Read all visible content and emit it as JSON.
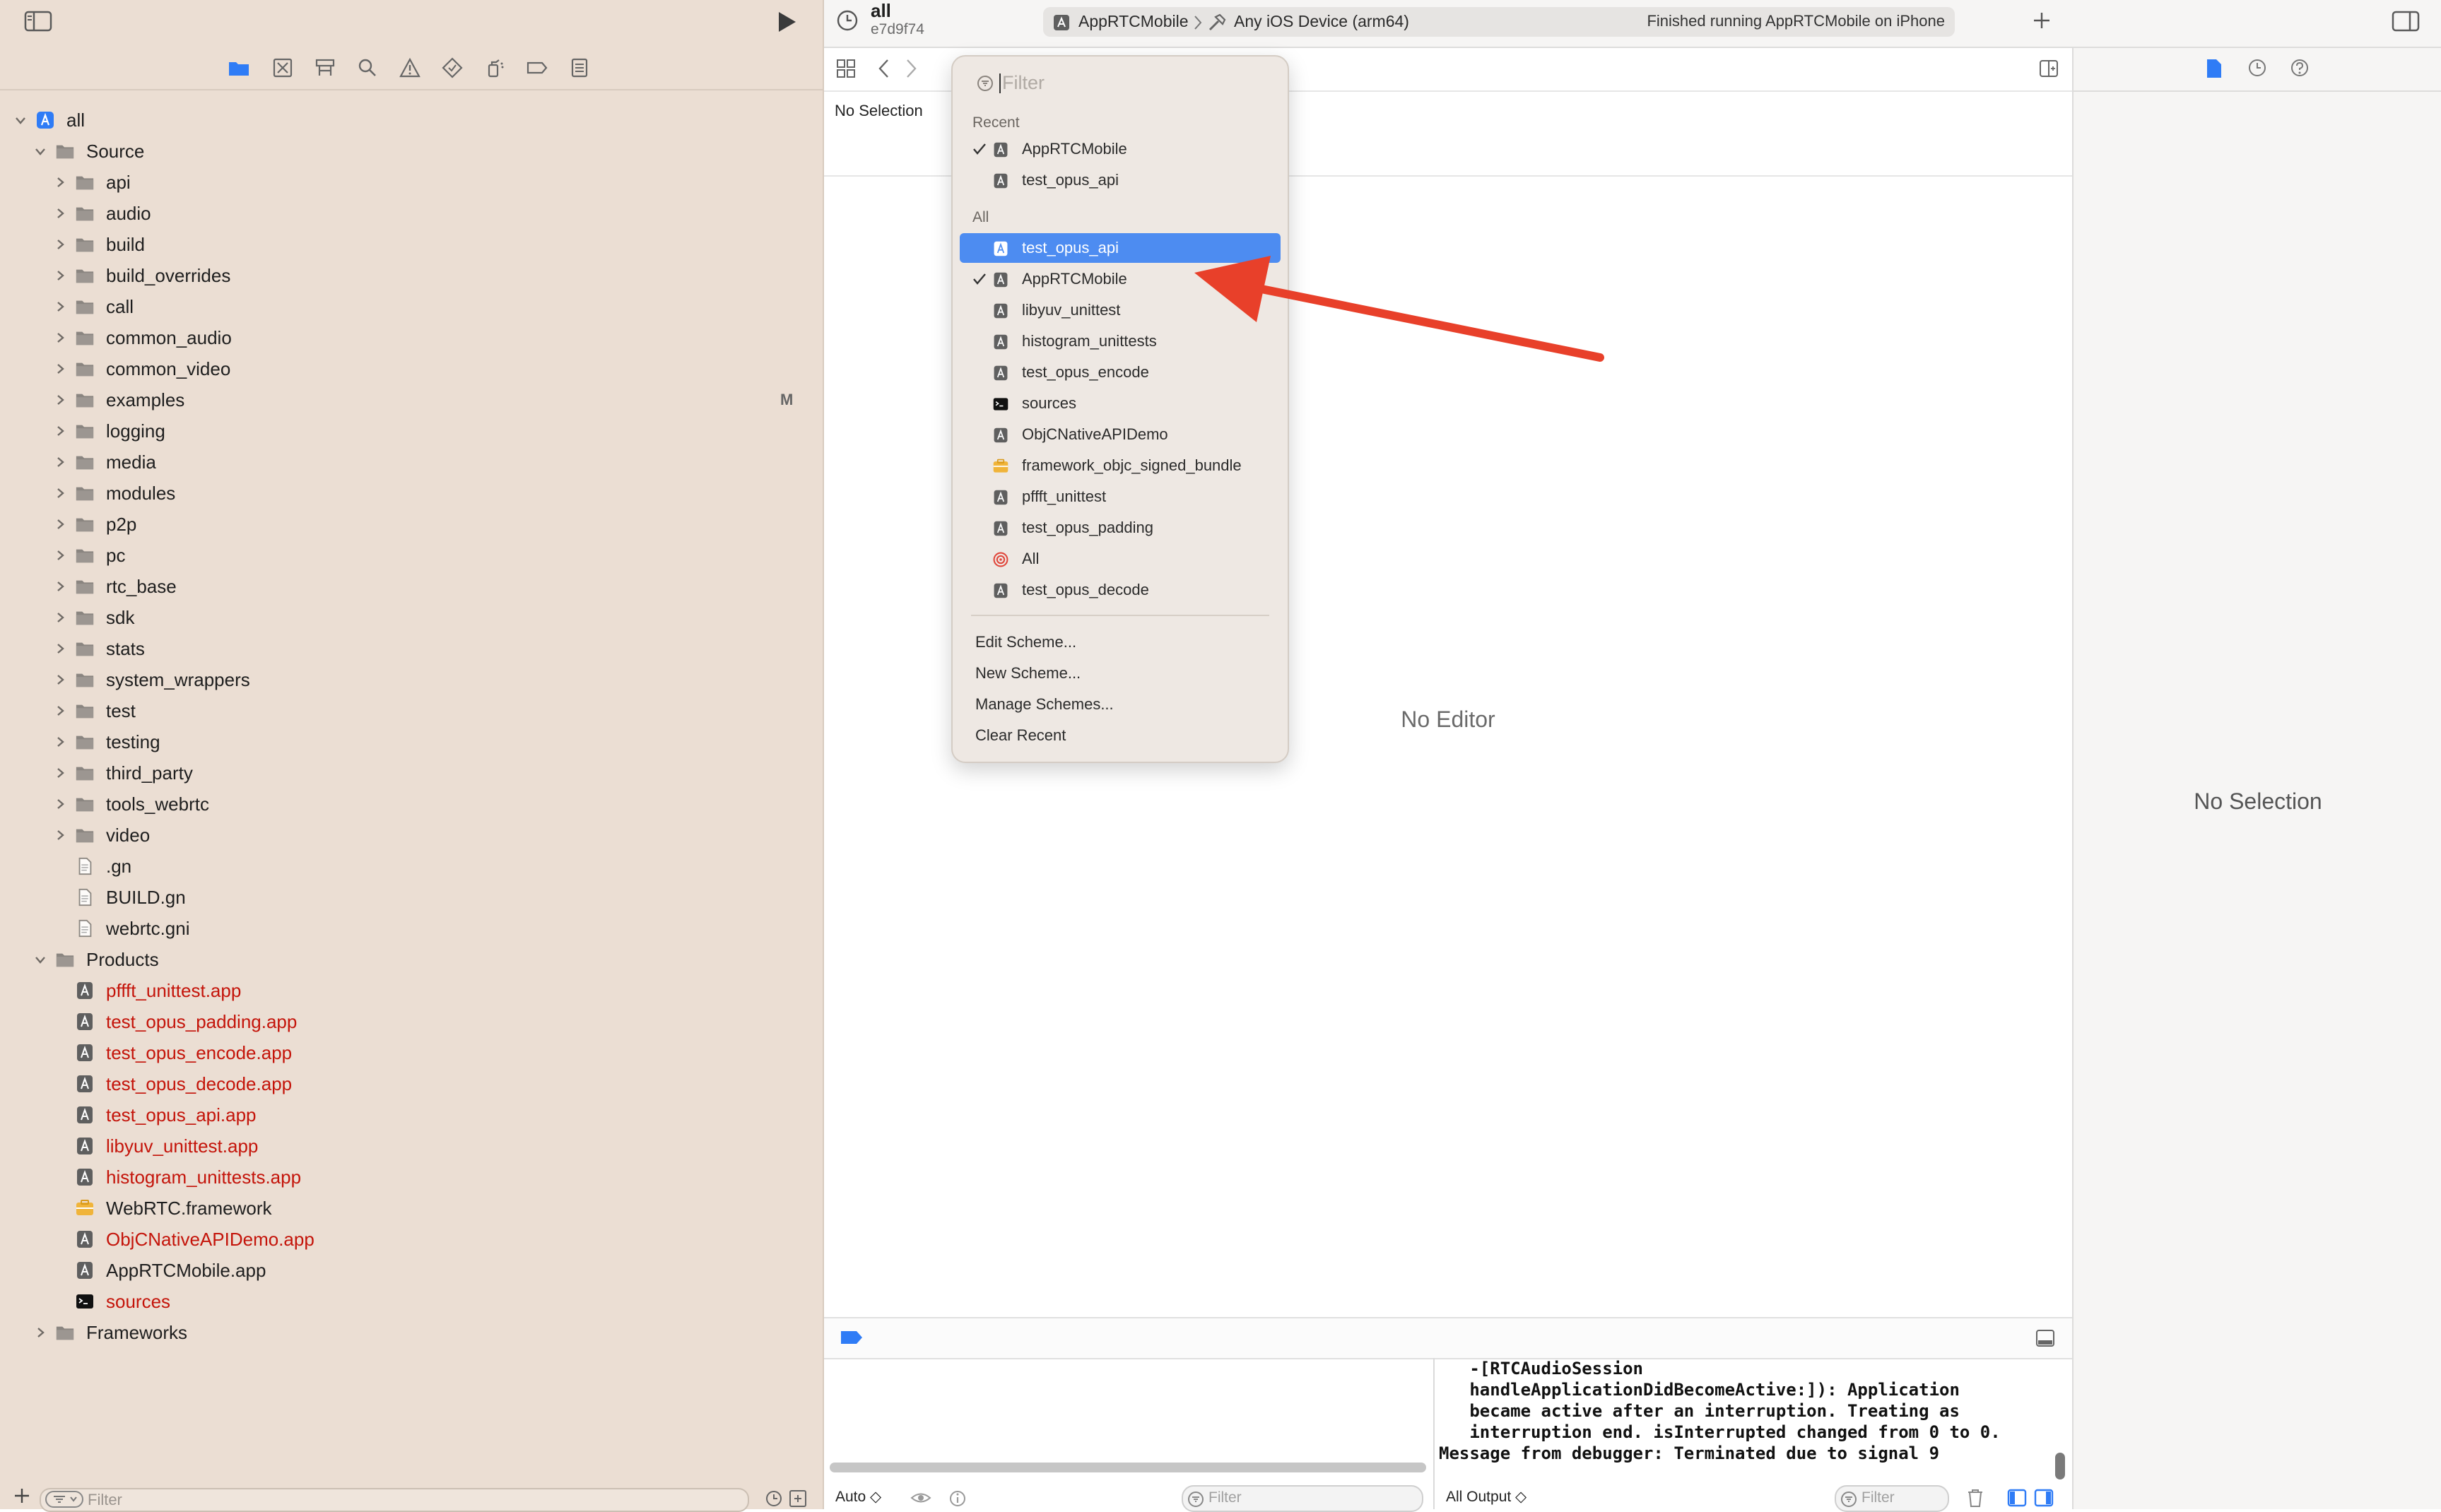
{
  "topbar": {
    "scheme_title": "all",
    "scheme_commit": "e7d9f74",
    "active_scheme": "AppRTCMobile",
    "destination": "Any iOS Device (arm64)",
    "status": "Finished running AppRTCMobile on iPhone"
  },
  "navigator": {
    "tree": [
      {
        "label": "all",
        "level": 0,
        "icon": "xcode-project-icon",
        "chevron": "down"
      },
      {
        "label": "Source",
        "level": 1,
        "icon": "folder-icon",
        "chevron": "down"
      },
      {
        "label": "api",
        "level": 2,
        "icon": "folder-icon",
        "chevron": "right"
      },
      {
        "label": "audio",
        "level": 2,
        "icon": "folder-icon",
        "chevron": "right"
      },
      {
        "label": "build",
        "level": 2,
        "icon": "folder-icon",
        "chevron": "right"
      },
      {
        "label": "build_overrides",
        "level": 2,
        "icon": "folder-icon",
        "chevron": "right"
      },
      {
        "label": "call",
        "level": 2,
        "icon": "folder-icon",
        "chevron": "right"
      },
      {
        "label": "common_audio",
        "level": 2,
        "icon": "folder-icon",
        "chevron": "right"
      },
      {
        "label": "common_video",
        "level": 2,
        "icon": "folder-icon",
        "chevron": "right"
      },
      {
        "label": "examples",
        "level": 2,
        "icon": "folder-icon",
        "chevron": "right",
        "badge": "M"
      },
      {
        "label": "logging",
        "level": 2,
        "icon": "folder-icon",
        "chevron": "right"
      },
      {
        "label": "media",
        "level": 2,
        "icon": "folder-icon",
        "chevron": "right"
      },
      {
        "label": "modules",
        "level": 2,
        "icon": "folder-icon",
        "chevron": "right"
      },
      {
        "label": "p2p",
        "level": 2,
        "icon": "folder-icon",
        "chevron": "right"
      },
      {
        "label": "pc",
        "level": 2,
        "icon": "folder-icon",
        "chevron": "right"
      },
      {
        "label": "rtc_base",
        "level": 2,
        "icon": "folder-icon",
        "chevron": "right"
      },
      {
        "label": "sdk",
        "level": 2,
        "icon": "folder-icon",
        "chevron": "right"
      },
      {
        "label": "stats",
        "level": 2,
        "icon": "folder-icon",
        "chevron": "right"
      },
      {
        "label": "system_wrappers",
        "level": 2,
        "icon": "folder-icon",
        "chevron": "right"
      },
      {
        "label": "test",
        "level": 2,
        "icon": "folder-icon",
        "chevron": "right"
      },
      {
        "label": "testing",
        "level": 2,
        "icon": "folder-icon",
        "chevron": "right"
      },
      {
        "label": "third_party",
        "level": 2,
        "icon": "folder-icon",
        "chevron": "right"
      },
      {
        "label": "tools_webrtc",
        "level": 2,
        "icon": "folder-icon",
        "chevron": "right"
      },
      {
        "label": "video",
        "level": 2,
        "icon": "folder-icon",
        "chevron": "right"
      },
      {
        "label": ".gn",
        "level": 2,
        "icon": "file-icon"
      },
      {
        "label": "BUILD.gn",
        "level": 2,
        "icon": "file-icon"
      },
      {
        "label": "webrtc.gni",
        "level": 2,
        "icon": "file-icon"
      },
      {
        "label": "Products",
        "level": 1,
        "icon": "folder-icon",
        "chevron": "down"
      },
      {
        "label": "pffft_unittest.app",
        "level": 2,
        "icon": "app-icon",
        "missing": true
      },
      {
        "label": "test_opus_padding.app",
        "level": 2,
        "icon": "app-icon",
        "missing": true
      },
      {
        "label": "test_opus_encode.app",
        "level": 2,
        "icon": "app-icon",
        "missing": true
      },
      {
        "label": "test_opus_decode.app",
        "level": 2,
        "icon": "app-icon",
        "missing": true
      },
      {
        "label": "test_opus_api.app",
        "level": 2,
        "icon": "app-icon",
        "missing": true
      },
      {
        "label": "libyuv_unittest.app",
        "level": 2,
        "icon": "app-icon",
        "missing": true
      },
      {
        "label": "histogram_unittests.app",
        "level": 2,
        "icon": "app-icon",
        "missing": true
      },
      {
        "label": "WebRTC.framework",
        "level": 2,
        "icon": "framework-icon"
      },
      {
        "label": "ObjCNativeAPIDemo.app",
        "level": 2,
        "icon": "app-icon",
        "missing": true
      },
      {
        "label": "AppRTCMobile.app",
        "level": 2,
        "icon": "app-icon"
      },
      {
        "label": "sources",
        "level": 2,
        "icon": "terminal-icon",
        "missing": true
      },
      {
        "label": "Frameworks",
        "level": 1,
        "icon": "folder-icon",
        "chevron": "right"
      }
    ],
    "filter_placeholder": "Filter"
  },
  "editor": {
    "no_selection": "No Selection",
    "no_editor": "No Editor"
  },
  "scheme_menu": {
    "filter_placeholder": "Filter",
    "recent_header": "Recent",
    "recent": [
      {
        "label": "AppRTCMobile",
        "checked": true,
        "icon": "app-icon"
      },
      {
        "label": "test_opus_api",
        "checked": false,
        "icon": "app-icon"
      }
    ],
    "all_header": "All",
    "all": [
      {
        "label": "test_opus_api",
        "checked": false,
        "icon": "app-icon",
        "selected": true
      },
      {
        "label": "AppRTCMobile",
        "checked": true,
        "icon": "app-icon"
      },
      {
        "label": "libyuv_unittest",
        "checked": false,
        "icon": "app-icon"
      },
      {
        "label": "histogram_unittests",
        "checked": false,
        "icon": "app-icon"
      },
      {
        "label": "test_opus_encode",
        "checked": false,
        "icon": "app-icon"
      },
      {
        "label": "sources",
        "checked": false,
        "icon": "terminal-icon"
      },
      {
        "label": "ObjCNativeAPIDemo",
        "checked": false,
        "icon": "app-icon"
      },
      {
        "label": "framework_objc_signed_bundle",
        "checked": false,
        "icon": "framework-icon"
      },
      {
        "label": "pffft_unittest",
        "checked": false,
        "icon": "app-icon"
      },
      {
        "label": "test_opus_padding",
        "checked": false,
        "icon": "app-icon"
      },
      {
        "label": "All",
        "checked": false,
        "icon": "target-icon"
      },
      {
        "label": "test_opus_decode",
        "checked": false,
        "icon": "app-icon"
      }
    ],
    "actions": [
      "Edit Scheme...",
      "New Scheme...",
      "Manage Schemes...",
      "Clear Recent"
    ]
  },
  "debug": {
    "vars_mode": "Auto ◇",
    "vars_filter_placeholder": "Filter",
    "console_mode": "All Output ◇",
    "console_filter_placeholder": "Filter",
    "console_lines": [
      "   -[RTCAudioSession",
      "   handleApplicationDidBecomeActive:]): Application",
      "   became active after an interruption. Treating as",
      "   interruption end. isInterrupted changed from 0 to 0.",
      "Message from debugger: Terminated due to signal 9"
    ]
  },
  "inspector": {
    "no_selection": "No Selection"
  },
  "colors": {
    "accent": "#4d8cf1",
    "missing_file": "#c4140a",
    "arrow": "#e8402a"
  }
}
